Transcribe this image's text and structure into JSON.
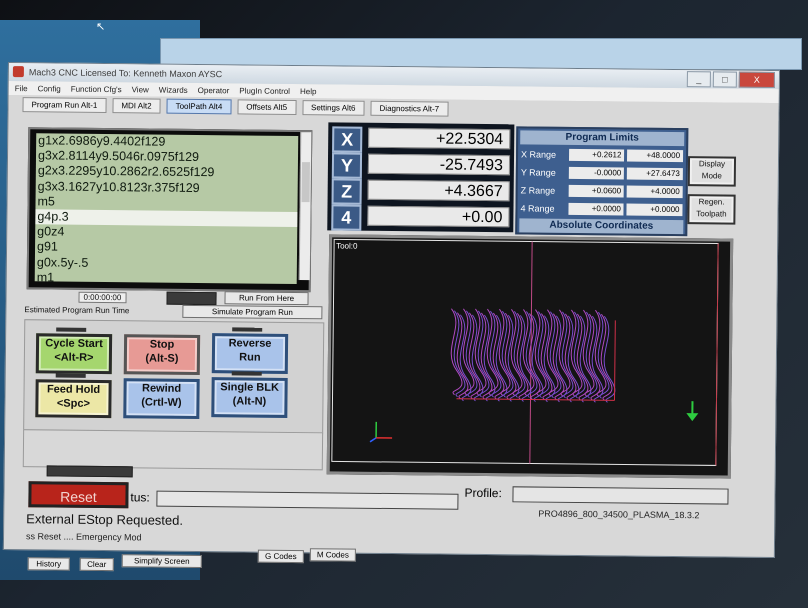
{
  "window": {
    "title": "Mach3 CNC  Licensed To: Kenneth Maxon AYSC",
    "controls": [
      "_",
      "□",
      "X"
    ]
  },
  "menu": [
    "File",
    "Config",
    "Function Cfg's",
    "View",
    "Wizards",
    "Operator",
    "PlugIn Control",
    "Help"
  ],
  "tabs": [
    {
      "label": "Program Run Alt-1",
      "active": false
    },
    {
      "label": "MDI Alt2",
      "active": false
    },
    {
      "label": "ToolPath Alt4",
      "active": true
    },
    {
      "label": "Offsets Alt5",
      "active": false
    },
    {
      "label": "Settings Alt6",
      "active": false
    },
    {
      "label": "Diagnostics Alt-7",
      "active": false
    }
  ],
  "gcode": {
    "lines": [
      "g1x2.6986y9.4402f129",
      "g3x2.8114y9.5046r.0975f129",
      "g2x3.2295y10.2862r2.6525f129",
      "g3x3.1627y10.8123r.375f129",
      "m5",
      "g4p.3",
      "g0z4",
      "g91",
      "g0x.5y-.5",
      "m1"
    ],
    "selected_index": 5
  },
  "run": {
    "time": "0:00:00:00",
    "time_label": "Estimated Program Run Time",
    "run_from_here": "Run From Here",
    "simulate": "Simulate Program Run"
  },
  "buttons": {
    "cycle_start": [
      "Cycle Start",
      "<Alt-R>"
    ],
    "stop": [
      "Stop",
      "(Alt-S)"
    ],
    "reverse_run": [
      "Reverse",
      "Run"
    ],
    "feed_hold": [
      "Feed Hold",
      "<Spc>"
    ],
    "rewind": [
      "Rewind",
      "(Crtl-W)"
    ],
    "single_blk": [
      "Single BLK",
      "(Alt-N)"
    ],
    "display_mode": [
      "Display",
      "Mode"
    ],
    "regen_toolpath": [
      "Regen.",
      "Toolpath"
    ]
  },
  "dro": [
    {
      "axis": "X",
      "value": "+22.5304"
    },
    {
      "axis": "Y",
      "value": "-25.7493"
    },
    {
      "axis": "Z",
      "value": "+4.3667"
    },
    {
      "axis": "4",
      "value": "+0.00"
    }
  ],
  "limits": {
    "title": "Program Limits",
    "rows": [
      {
        "label": "X Range",
        "min": "+0.2612",
        "max": "+48.0000"
      },
      {
        "label": "Y Range",
        "min": "-0.0000",
        "max": "+27.6473"
      },
      {
        "label": "Z Range",
        "min": "+0.0600",
        "max": "+4.0000"
      },
      {
        "label": "4 Range",
        "min": "+0.0000",
        "max": "+0.0000"
      }
    ],
    "footer": "Absolute Coordinates"
  },
  "toolpath": {
    "tool_label": "Tool:0"
  },
  "status": {
    "reset": "Reset",
    "status_label": "tus:",
    "profile_label": "Profile:",
    "profile_name": "PRO4896_800_34500_PLASMA_18.3.2",
    "message": "External EStop Requested.",
    "history_line": "ss Reset .... Emergency Mod"
  },
  "bottom_buttons": [
    "History",
    "Clear",
    "Simplify Screen",
    "G Codes",
    "M Codes"
  ],
  "colors": {
    "led_green": "#2f8a3a",
    "reset_red": "#b8241b",
    "dro_blue": "#3b5a86",
    "toolpath_magenta": "#b04ac0"
  }
}
